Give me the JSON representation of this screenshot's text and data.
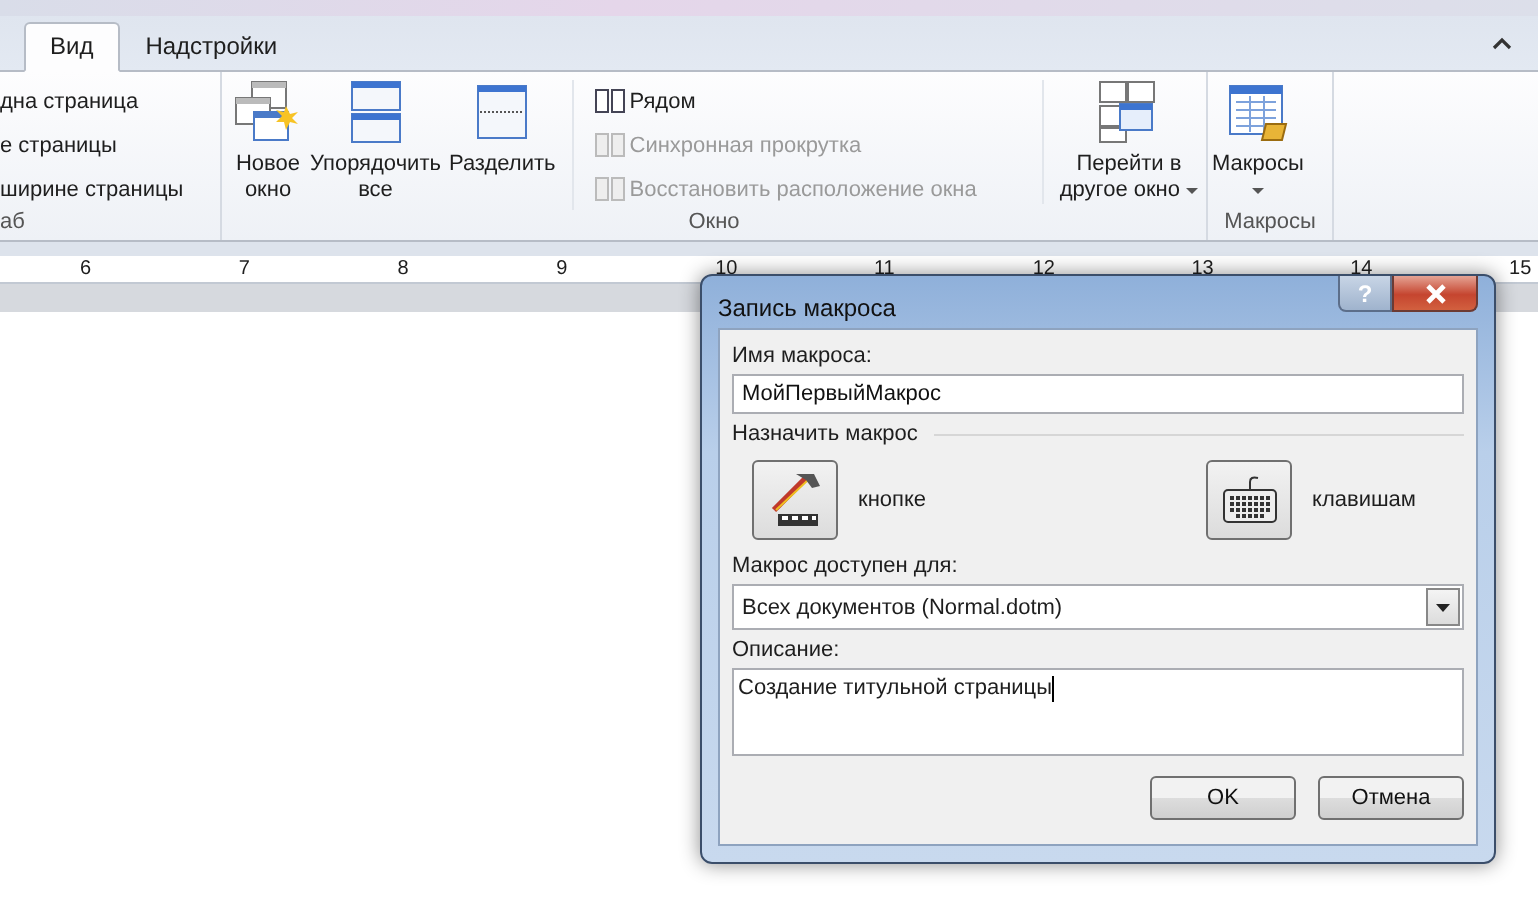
{
  "ribbon": {
    "tabs": [
      {
        "label": "Вид",
        "selected": true
      },
      {
        "label": "Надстройки",
        "selected": false
      }
    ],
    "groups": [
      {
        "label": "аб",
        "items": [
          {
            "kind": "stack",
            "items": [
              {
                "label": "дна страница",
                "disabled": false
              },
              {
                "label": "е страницы",
                "disabled": false
              },
              {
                "label": "ширине страницы",
                "disabled": false
              }
            ]
          }
        ]
      },
      {
        "label": "Окно",
        "items": [
          {
            "kind": "large",
            "lines": [
              "Новое",
              "окно"
            ],
            "dropdown": false
          },
          {
            "kind": "large",
            "lines": [
              "Упорядочить",
              "все"
            ],
            "dropdown": false
          },
          {
            "kind": "large",
            "lines": [
              "Разделить"
            ],
            "dropdown": false
          },
          {
            "kind": "stack",
            "items": [
              {
                "label": "Рядом",
                "disabled": false
              },
              {
                "label": "Синхронная прокрутка",
                "disabled": true
              },
              {
                "label": "Восстановить расположение окна",
                "disabled": true
              }
            ]
          },
          {
            "kind": "large",
            "lines": [
              "Перейти в",
              "другое окно"
            ],
            "dropdown": true
          }
        ]
      },
      {
        "label": "Макросы",
        "items": [
          {
            "kind": "large",
            "lines": [
              "Макросы"
            ],
            "dropdown": true
          }
        ]
      }
    ]
  },
  "ruler": [
    "6",
    "7",
    "8",
    "9",
    "10",
    "11",
    "12",
    "13",
    "14",
    "15"
  ],
  "dialog": {
    "title": "Запись макроса",
    "help": "?",
    "name_label": "Имя макроса:",
    "name_value": "МойПервыйМакрос",
    "assign_label": "Назначить макрос",
    "assign_buttons": [
      {
        "label": "кнопке"
      },
      {
        "label": "клавишам"
      }
    ],
    "store_label": "Макрос доступен для:",
    "store_value": "Всех документов (Normal.dotm)",
    "description_label": "Описание:",
    "description_value": "Создание титульной страницы",
    "buttons": [
      "OK",
      "Отмена"
    ]
  }
}
